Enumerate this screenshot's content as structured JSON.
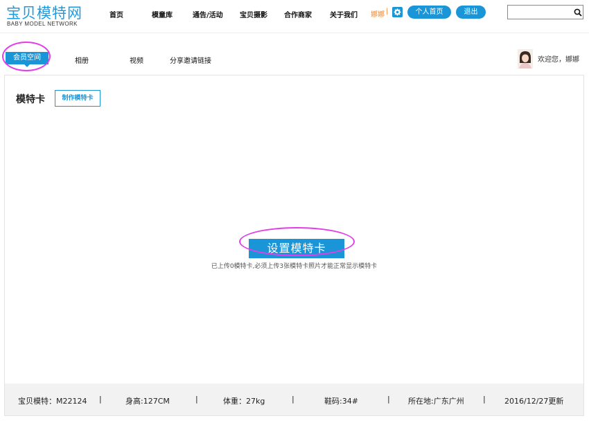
{
  "header": {
    "logo_cn": "宝贝模特网",
    "logo_en": "BABY MODEL NETWORK",
    "nav": [
      "首页",
      "模童库",
      "通告/活动",
      "宝贝摄影",
      "合作商家",
      "关于我们"
    ],
    "user_name": "娜娜",
    "user_sep": "|",
    "home_button": "个人首页",
    "logout_button": "退出",
    "search_value": ""
  },
  "tabs": {
    "active": "会员空间",
    "items": [
      "相册",
      "视频",
      "分享邀请链接"
    ]
  },
  "welcome_text": "欢迎您，娜娜",
  "main": {
    "section_title": "模特卡",
    "make_card_button": "制作模特卡",
    "setup_button": "设置模特卡",
    "setup_hint": "已上传0模特卡,必须上传3张模特卡照片才能正常显示模特卡"
  },
  "info_bar": {
    "items": [
      "宝贝模特：M22124",
      "身高:127CM",
      "体重：27kg",
      "鞋码:34#",
      "所在地:广东广州",
      "2016/12/27更新"
    ],
    "separator": "|"
  },
  "colors": {
    "accent": "#1a96d8",
    "user_name": "#f0862b",
    "highlight_ring": "#e23ee8"
  },
  "icons": {
    "settings": "gear-icon",
    "search": "search-icon"
  }
}
